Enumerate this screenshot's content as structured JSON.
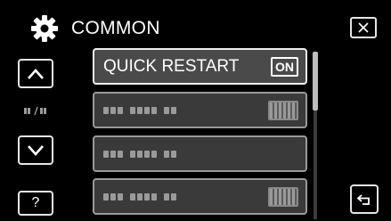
{
  "header": {
    "title": "COMMON"
  },
  "menu": {
    "items": [
      {
        "label": "QUICK RESTART",
        "value": "ON",
        "active": true
      },
      {
        "label": "",
        "value": "",
        "active": false
      },
      {
        "label": "",
        "value": "",
        "active": false
      },
      {
        "label": "",
        "value": "",
        "active": false
      }
    ]
  },
  "nav": {
    "help_label": "?"
  },
  "icons": {
    "gear": "gear-icon",
    "close": "close-icon",
    "up": "chevron-up-icon",
    "down": "chevron-down-icon",
    "page": "page-indicator-icon",
    "back": "back-arrow-icon"
  },
  "colors": {
    "background": "#000000",
    "border": "#e6e6e6",
    "item_bg": "#3a3a3a"
  }
}
